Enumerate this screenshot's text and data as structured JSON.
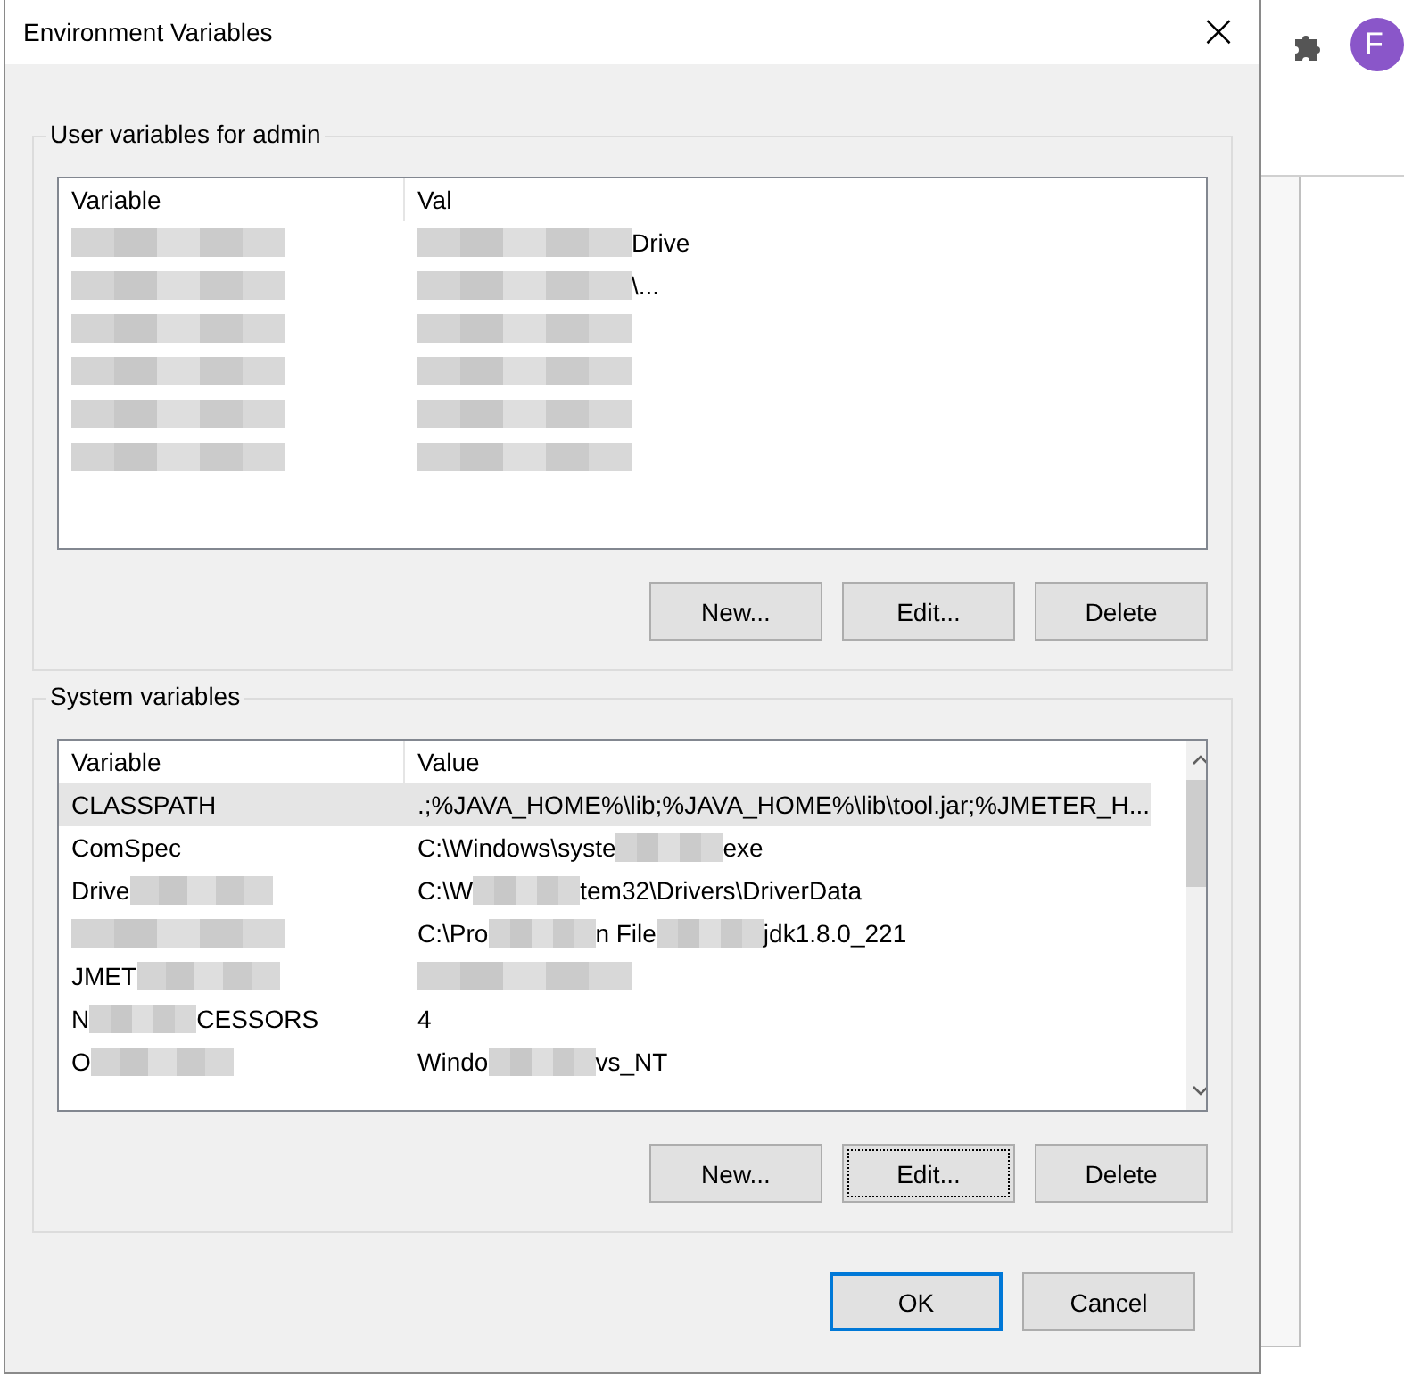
{
  "window": {
    "title": "Environment Variables",
    "close": "×"
  },
  "browser": {
    "avatar": "F"
  },
  "user_group": {
    "title": "User variables for admin",
    "columns": [
      "Variable",
      "Val"
    ],
    "rows": [
      {
        "selected": false,
        "variable": {
          "redacted": true
        },
        "value": {
          "lead_blur": true,
          "parts": [
            "Drive"
          ]
        }
      },
      {
        "selected": false,
        "variable": {
          "redacted": true
        },
        "value": {
          "lead_blur": true,
          "parts": [
            "\\..."
          ]
        }
      },
      {
        "selected": false,
        "variable": {
          "redacted": true
        },
        "value": {
          "redacted": true
        }
      },
      {
        "selected": false,
        "variable": {
          "redacted": true
        },
        "value": {
          "redacted": true
        }
      },
      {
        "selected": false,
        "variable": {
          "redacted": true
        },
        "value": {
          "redacted": true
        }
      },
      {
        "selected": false,
        "variable": {
          "redacted": true
        },
        "value": {
          "redacted": true
        }
      }
    ],
    "buttons": [
      {
        "label": "New...",
        "focused": false
      },
      {
        "label": "Edit...",
        "focused": false
      },
      {
        "label": "Delete",
        "focused": false
      }
    ]
  },
  "system_group": {
    "title": "System variables",
    "columns": [
      "Variable",
      "Value"
    ],
    "rows": [
      {
        "selected": true,
        "variable": {
          "parts": [
            "CLASSPATH"
          ]
        },
        "value": {
          "parts": [
            ".;%JAVA_HOME%\\lib;%JAVA_HOME%\\lib\\tool.jar;%JMETER_H..."
          ]
        }
      },
      {
        "selected": false,
        "variable": {
          "parts": [
            "ComSpec"
          ]
        },
        "value": {
          "parts": [
            "C:\\Windows\\syste",
            "exe"
          ]
        }
      },
      {
        "selected": false,
        "variable": {
          "parts": [
            "Drive"
          ],
          "redacted": true
        },
        "value": {
          "parts": [
            "C:\\W",
            "tem32\\Drivers\\DriverData"
          ]
        }
      },
      {
        "selected": false,
        "variable": {
          "redacted": true
        },
        "value": {
          "parts": [
            "C:\\Pro",
            "n File",
            "jdk1.8.0_221"
          ]
        }
      },
      {
        "selected": false,
        "variable": {
          "parts": [
            "JMET"
          ],
          "redacted": true
        },
        "value": {
          "redacted": true
        }
      },
      {
        "selected": false,
        "variable": {
          "parts": [
            "N",
            "CESSORS"
          ]
        },
        "value": {
          "parts": [
            "4"
          ]
        }
      },
      {
        "selected": false,
        "variable": {
          "parts": [
            "O"
          ],
          "redacted": true
        },
        "value": {
          "parts": [
            "Windo",
            "vs_NT"
          ]
        }
      }
    ],
    "buttons": [
      {
        "label": "New...",
        "focused": false
      },
      {
        "label": "Edit...",
        "focused": true
      },
      {
        "label": "Delete",
        "focused": false
      }
    ]
  },
  "footer_buttons": [
    {
      "label": "OK",
      "default": true
    },
    {
      "label": "Cancel",
      "default": false
    }
  ]
}
